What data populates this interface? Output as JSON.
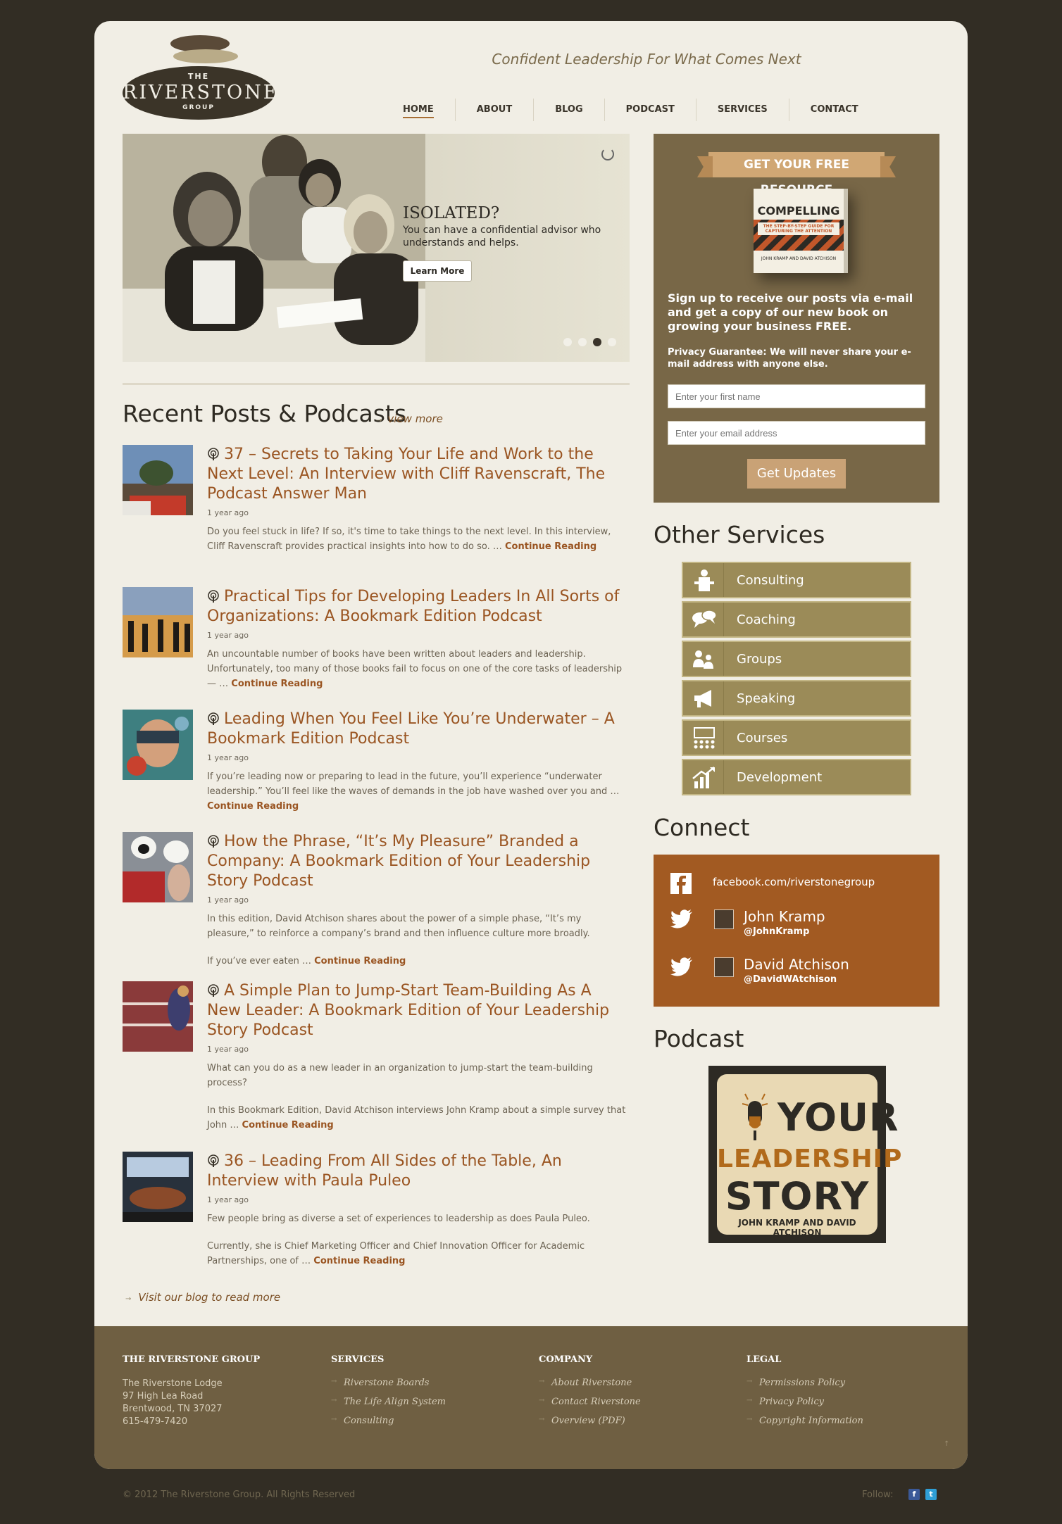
{
  "header": {
    "logo_the": "THE",
    "logo_name": "RIVERSTONE",
    "logo_group": "GROUP",
    "tagline": "Confident Leadership For What Comes Next",
    "nav": [
      {
        "label": "HOME",
        "active": true
      },
      {
        "label": "ABOUT"
      },
      {
        "label": "BLOG"
      },
      {
        "label": "PODCAST"
      },
      {
        "label": "SERVICES"
      },
      {
        "label": "CONTACT"
      }
    ]
  },
  "hero": {
    "title": "ISOLATED?",
    "text": "You can have a confidential advisor who understands and helps.",
    "button": "Learn More",
    "slide_count": 4,
    "active_slide": 3
  },
  "posts": {
    "heading": "Recent Posts & Podcasts",
    "view_more": "view more",
    "continue_label": "Continue Reading",
    "items": [
      {
        "title": "37 – Secrets to Taking Your Life and Work to the Next Level: An Interview with Cliff Ravenscraft, The Podcast Answer Man",
        "date": "1 year ago",
        "excerpt": [
          "Do you feel stuck in life? If so, it's time to take things to the next level. In this interview, Cliff Ravenscraft provides practical insights into how to do so. …"
        ]
      },
      {
        "title": "Practical Tips for Developing Leaders In All Sorts of Organizations: A Bookmark Edition Podcast",
        "date": "1 year ago",
        "excerpt": [
          "An uncountable number of books have been written about leaders and leadership. Unfortunately, too many of those books fail to focus on one of the core tasks of leadership — …"
        ]
      },
      {
        "title": "Leading When You Feel Like You’re Underwater – A Bookmark Edition Podcast",
        "date": "1 year ago",
        "excerpt": [
          "If you’re leading now or preparing to lead in the future, you’ll experience “underwater leadership.” You’ll feel like the waves of demands in the job have washed over you and …"
        ]
      },
      {
        "title": "How the Phrase, “It’s My Pleasure” Branded a Company: A Bookmark Edition of Your Leadership Story Podcast",
        "date": "1 year ago",
        "excerpt": [
          "In this edition, David Atchison shares about the power of a simple phase, “It’s my pleasure,” to reinforce a company’s brand and then influence culture more broadly.",
          "If you’ve ever eaten …"
        ]
      },
      {
        "title": "A Simple Plan to Jump-Start Team-Building As A New Leader: A Bookmark Edition of Your Leadership Story Podcast",
        "date": "1 year ago",
        "excerpt": [
          "What can you do as a new leader in an organization to jump-start the team-building process?",
          "In this Bookmark Edition, David Atchison interviews John Kramp about a simple survey that John …"
        ]
      },
      {
        "title": "36 – Leading From All Sides of the Table, An Interview with Paula Puleo",
        "date": "1 year ago",
        "excerpt": [
          "Few people bring as diverse a set of experiences to leadership as does Paula Puleo.",
          "Currently, she is Chief Marketing Officer and Chief Innovation Officer for Academic Partnerships, one of …"
        ]
      }
    ],
    "visit_blog": "Visit our blog to read more"
  },
  "resource": {
    "ribbon": "GET YOUR FREE RESOURCE",
    "book_title": "COMPELLING",
    "book_subtitle": "THE STEP-BY-STEP GUIDE FOR CAPTURING THE ATTENTION",
    "book_authors": "JOHN KRAMP AND DAVID ATCHISON",
    "lead": "Sign up to receive our posts via e-mail and get a copy of our new book on growing your business FREE.",
    "privacy": "Privacy Guarantee: We will never share your e-mail address with anyone else.",
    "first_name_placeholder": "Enter your first name",
    "email_placeholder": "Enter your email address",
    "button": "Get Updates"
  },
  "services": {
    "heading": "Other Services",
    "items": [
      {
        "label": "Consulting",
        "icon": "podium-icon"
      },
      {
        "label": "Coaching",
        "icon": "speech-bubbles-icon"
      },
      {
        "label": "Groups",
        "icon": "people-icon"
      },
      {
        "label": "Speaking",
        "icon": "megaphone-icon"
      },
      {
        "label": "Courses",
        "icon": "classroom-icon"
      },
      {
        "label": "Development",
        "icon": "growth-chart-icon"
      }
    ]
  },
  "connect": {
    "heading": "Connect",
    "facebook": "facebook.com/riverstonegroup",
    "twitter": [
      {
        "name": "John Kramp",
        "handle": "@JohnKramp"
      },
      {
        "name": "David Atchison",
        "handle": "@DavidWAtchison"
      }
    ]
  },
  "podcast": {
    "heading": "Podcast",
    "line1": "YOUR",
    "line2": "LEADERSHIP",
    "line3": "STORY",
    "authors": "JOHN KRAMP AND DAVID ATCHISON"
  },
  "footer": {
    "col1_head": "THE RIVERSTONE GROUP",
    "address": [
      "The Riverstone Lodge",
      "97 High Lea Road",
      "Brentwood, TN 37027",
      "615-479-7420"
    ],
    "col2_head": "SERVICES",
    "services_links": [
      "Riverstone Boards",
      "The Life Align System",
      "Consulting"
    ],
    "col3_head": "COMPANY",
    "company_links": [
      "About Riverstone",
      "Contact Riverstone",
      "Overview (PDF)"
    ],
    "col4_head": "LEGAL",
    "legal_links": [
      "Permissions Policy",
      "Privacy Policy",
      "Copyright Information"
    ],
    "corner": "↑"
  },
  "bottom": {
    "copyright": "© 2012 The Riverstone Group. All Rights Reserved",
    "follow": "Follow:",
    "facebook_glyph": "f",
    "twitter_glyph": "t"
  },
  "colors": {
    "page_bg": "#322d24",
    "content_bg": "#f1eee5",
    "link": "#9a5522",
    "resource_bg": "#786747",
    "service_bg": "#9b8b58",
    "connect_bg": "#a25a22",
    "footer_bg": "#6f5f42"
  }
}
